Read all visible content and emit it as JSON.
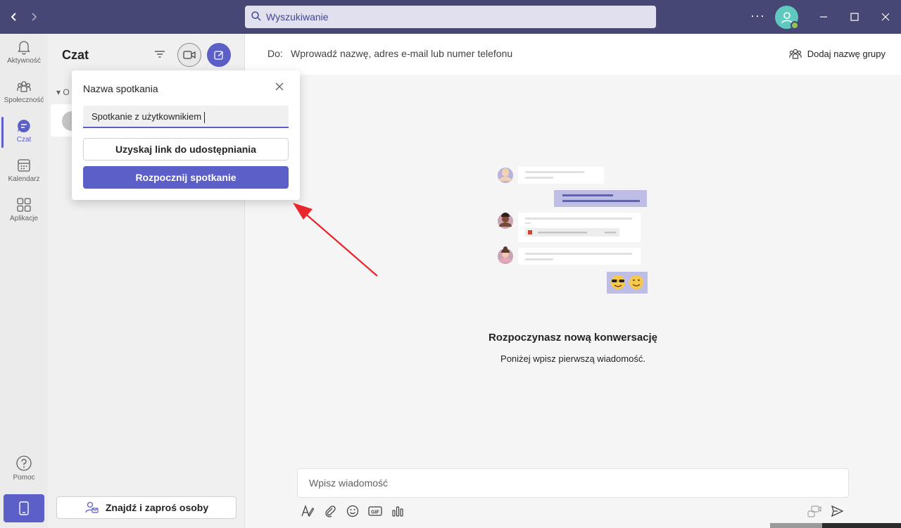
{
  "titlebar": {
    "search_placeholder": "Wyszukiwanie",
    "more_label": "···"
  },
  "rail": {
    "items": [
      {
        "label": "Aktywność",
        "icon": "bell-icon"
      },
      {
        "label": "Społeczność",
        "icon": "community-icon"
      },
      {
        "label": "Czat",
        "icon": "chat-icon",
        "active": true
      },
      {
        "label": "Kalendarz",
        "icon": "calendar-icon"
      },
      {
        "label": "Aplikacje",
        "icon": "apps-icon"
      }
    ],
    "help_label": "Pomoc"
  },
  "chat_panel": {
    "title": "Czat",
    "section_initial": "O",
    "invite_label": "Znajdź i zaproś osoby"
  },
  "main": {
    "to_label": "Do:",
    "to_placeholder": "Wprowadź nazwę, adres e-mail lub numer telefonu",
    "group_label": "Dodaj nazwę grupy",
    "empty_title": "Rozpoczynasz nową konwersację",
    "empty_subtitle": "Poniżej wpisz pierwszą wiadomość.",
    "message_placeholder": "Wpisz wiadomość",
    "gif_label": "GIF"
  },
  "meeting_popup": {
    "title": "Nazwa spotkania",
    "name_value": "Spotkanie z użytkownikiem",
    "link_button": "Uzyskaj link do udostępniania",
    "start_button": "Rozpocznij spotkanie"
  },
  "colors": {
    "titlebar": "#464775",
    "accent": "#5b5fc7",
    "annotation_arrow": "#e8262b"
  }
}
